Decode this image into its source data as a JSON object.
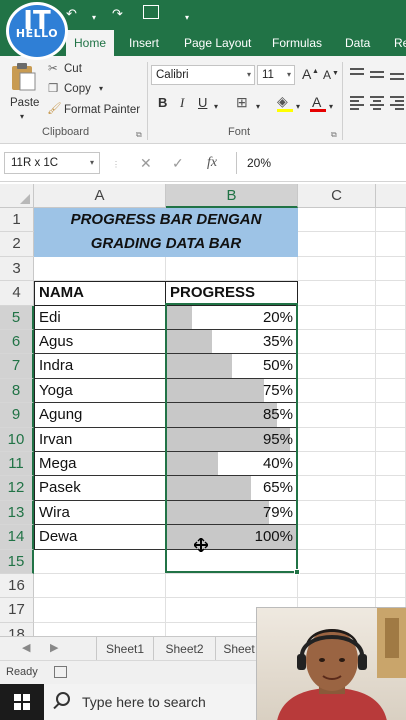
{
  "app": {
    "logo_text_top": "IT",
    "logo_text_bottom": "HELLO",
    "brand_color": "#217346"
  },
  "ribbon": {
    "tabs": [
      "Home",
      "Insert",
      "Page Layout",
      "Formulas",
      "Data",
      "Re"
    ],
    "active_tab": "Home",
    "clipboard": {
      "paste": "Paste",
      "cut": "Cut",
      "copy": "Copy",
      "format_painter": "Format Painter",
      "group_label": "Clipboard"
    },
    "font": {
      "family": "Calibri",
      "size": "11",
      "bold": "B",
      "italic": "I",
      "underline": "U",
      "grow": "A",
      "shrink": "A",
      "color_glyph": "A",
      "group_label": "Font"
    }
  },
  "formula_bar": {
    "name_box": "11R x 1C",
    "cancel_icon": "✕",
    "enter_icon": "✓",
    "fx_label": "fx",
    "value": "20%"
  },
  "grid": {
    "columns": [
      "A",
      "B",
      "C"
    ],
    "row_numbers": [
      "1",
      "2",
      "3",
      "4",
      "5",
      "6",
      "7",
      "8",
      "9",
      "10",
      "11",
      "12",
      "13",
      "14",
      "15",
      "16",
      "17",
      "18"
    ],
    "title_line1": "PROGRESS BAR DENGAN",
    "title_line2": "GRADING DATA BAR",
    "header_name": "NAMA",
    "header_progress": "PROGRESS",
    "rows": [
      {
        "name": "Edi",
        "progress": "20%",
        "fill": 0.2
      },
      {
        "name": "Agus",
        "progress": "35%",
        "fill": 0.35
      },
      {
        "name": "Indra",
        "progress": "50%",
        "fill": 0.5
      },
      {
        "name": "Yoga",
        "progress": "75%",
        "fill": 0.75
      },
      {
        "name": "Agung",
        "progress": "85%",
        "fill": 0.85
      },
      {
        "name": "Irvan",
        "progress": "95%",
        "fill": 0.95
      },
      {
        "name": "Mega",
        "progress": "40%",
        "fill": 0.4
      },
      {
        "name": "Pasek",
        "progress": "65%",
        "fill": 0.65
      },
      {
        "name": "Wira",
        "progress": "79%",
        "fill": 0.79
      },
      {
        "name": "Dewa",
        "progress": "100%",
        "fill": 1.0
      }
    ],
    "title_fill_color": "#9dc3e6",
    "data_bar_color": "#c8c8c8"
  },
  "sheets": {
    "tabs": [
      "Sheet1",
      "Sheet2",
      "Sheet"
    ],
    "prev_icon": "◀",
    "next_icon": "▶"
  },
  "status": {
    "text": "Ready"
  },
  "taskbar": {
    "search_placeholder": "Type here to search"
  }
}
